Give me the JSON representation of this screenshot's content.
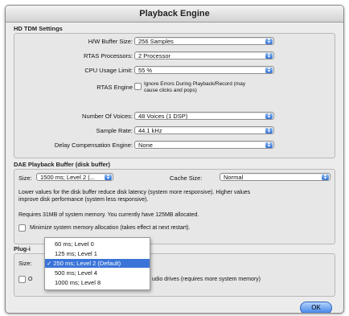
{
  "window": {
    "title": "Playback Engine"
  },
  "hd_tdm": {
    "title": "HD TDM Settings",
    "hw_buffer": {
      "label": "H/W Buffer Size:",
      "value": "256 Samples"
    },
    "rtas_processors": {
      "label": "RTAS Processors:",
      "value": "2 Processor"
    },
    "cpu_limit": {
      "label": "CPU Usage Limit:",
      "value": "55 %"
    },
    "rtas_engine": {
      "label": "RTAS Engine",
      "option_line1": "Ignore Errors During Playback/Record (may",
      "option_line2": "cause clicks and pops)"
    },
    "voices": {
      "label": "Number Of Voices:",
      "value": "48 Voices (1 DSP)"
    },
    "sample_rate": {
      "label": "Sample Rate:",
      "value": "44.1 kHz"
    },
    "delay_comp": {
      "label": "Delay Compensation Engine:",
      "value": "None"
    }
  },
  "dae": {
    "title": "DAE Playback Buffer (disk buffer)",
    "size_label": "Size:",
    "size_value": "1500 ms; Level 2 (...",
    "cache_label": "Cache Size:",
    "cache_value": "Normal",
    "desc_line1": "Lower values for the disk buffer reduce disk latency (system more responsive).  Higher values",
    "desc_line2": "improve disk performance (system less responsive).",
    "memory_note": "Requires 31MB of system memory. You currently have 125MB allocated.",
    "minimize_label": "Minimize system memory allocation (takes effect at next restart)."
  },
  "plugin": {
    "title": "Plug-i",
    "size_label": "Size:",
    "option_prefix": "O",
    "option_text": "udio drives (requires more system memory)"
  },
  "dropdown": {
    "items": [
      {
        "label": "60 ms; Level 0",
        "checked": false
      },
      {
        "label": "125 ms; Level 1",
        "checked": false
      },
      {
        "label": "250 ms; Level 2 (Default)",
        "checked": true
      },
      {
        "label": "500 ms; Level 4",
        "checked": false
      },
      {
        "label": "1000 ms; Level 8",
        "checked": false
      }
    ],
    "checkmark": "✓"
  },
  "buttons": {
    "ok": "OK"
  },
  "colors": {
    "accent": "#3a74d8"
  }
}
